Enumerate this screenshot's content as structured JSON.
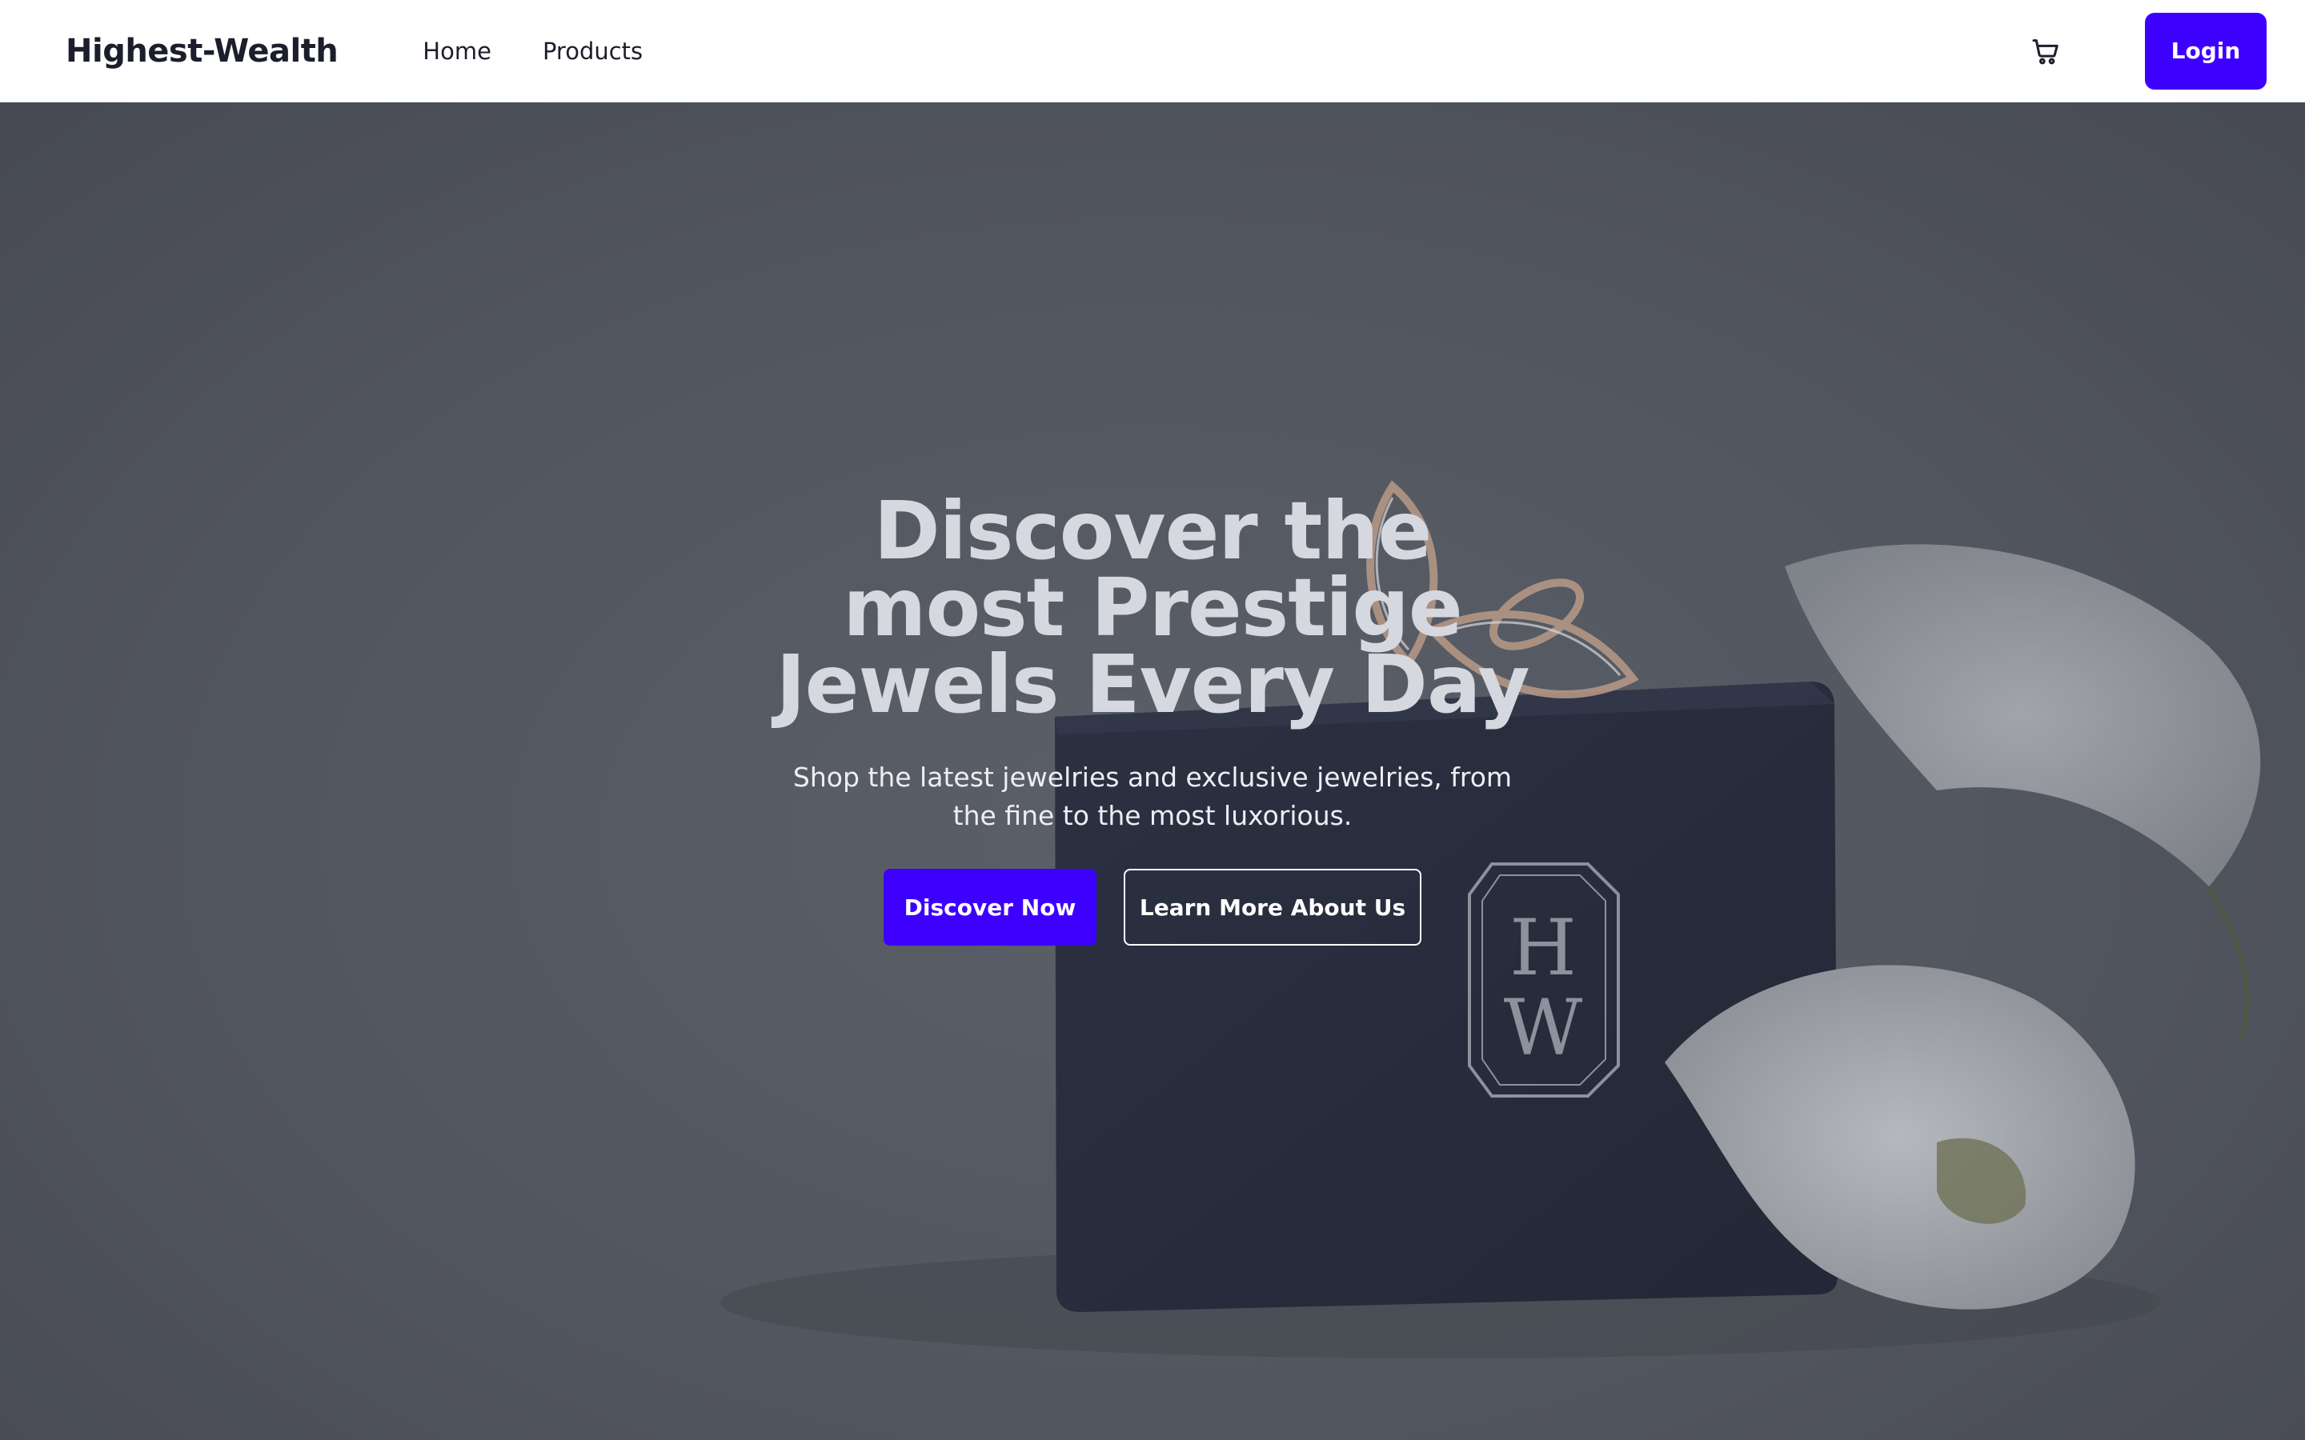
{
  "header": {
    "brand": "Highest-Wealth",
    "nav": [
      {
        "label": "Home"
      },
      {
        "label": "Products"
      }
    ],
    "cart_icon": "cart-icon",
    "login_label": "Login"
  },
  "hero": {
    "title_lines": [
      "Discover the",
      "most Prestige",
      "Jewels Every Day"
    ],
    "subtitle": "Shop the latest jewelries and exclusive jewelries, from the fine to the most luxorious.",
    "primary_button": "Discover Now",
    "secondary_button": "Learn More About Us",
    "background_image": "jewelry box with ring and white calla lily",
    "box_monogram": [
      "H",
      "W"
    ]
  },
  "colors": {
    "accent": "#3d00ff",
    "hero_overlay": "#52565f",
    "nav_text": "#1c1f2b"
  }
}
